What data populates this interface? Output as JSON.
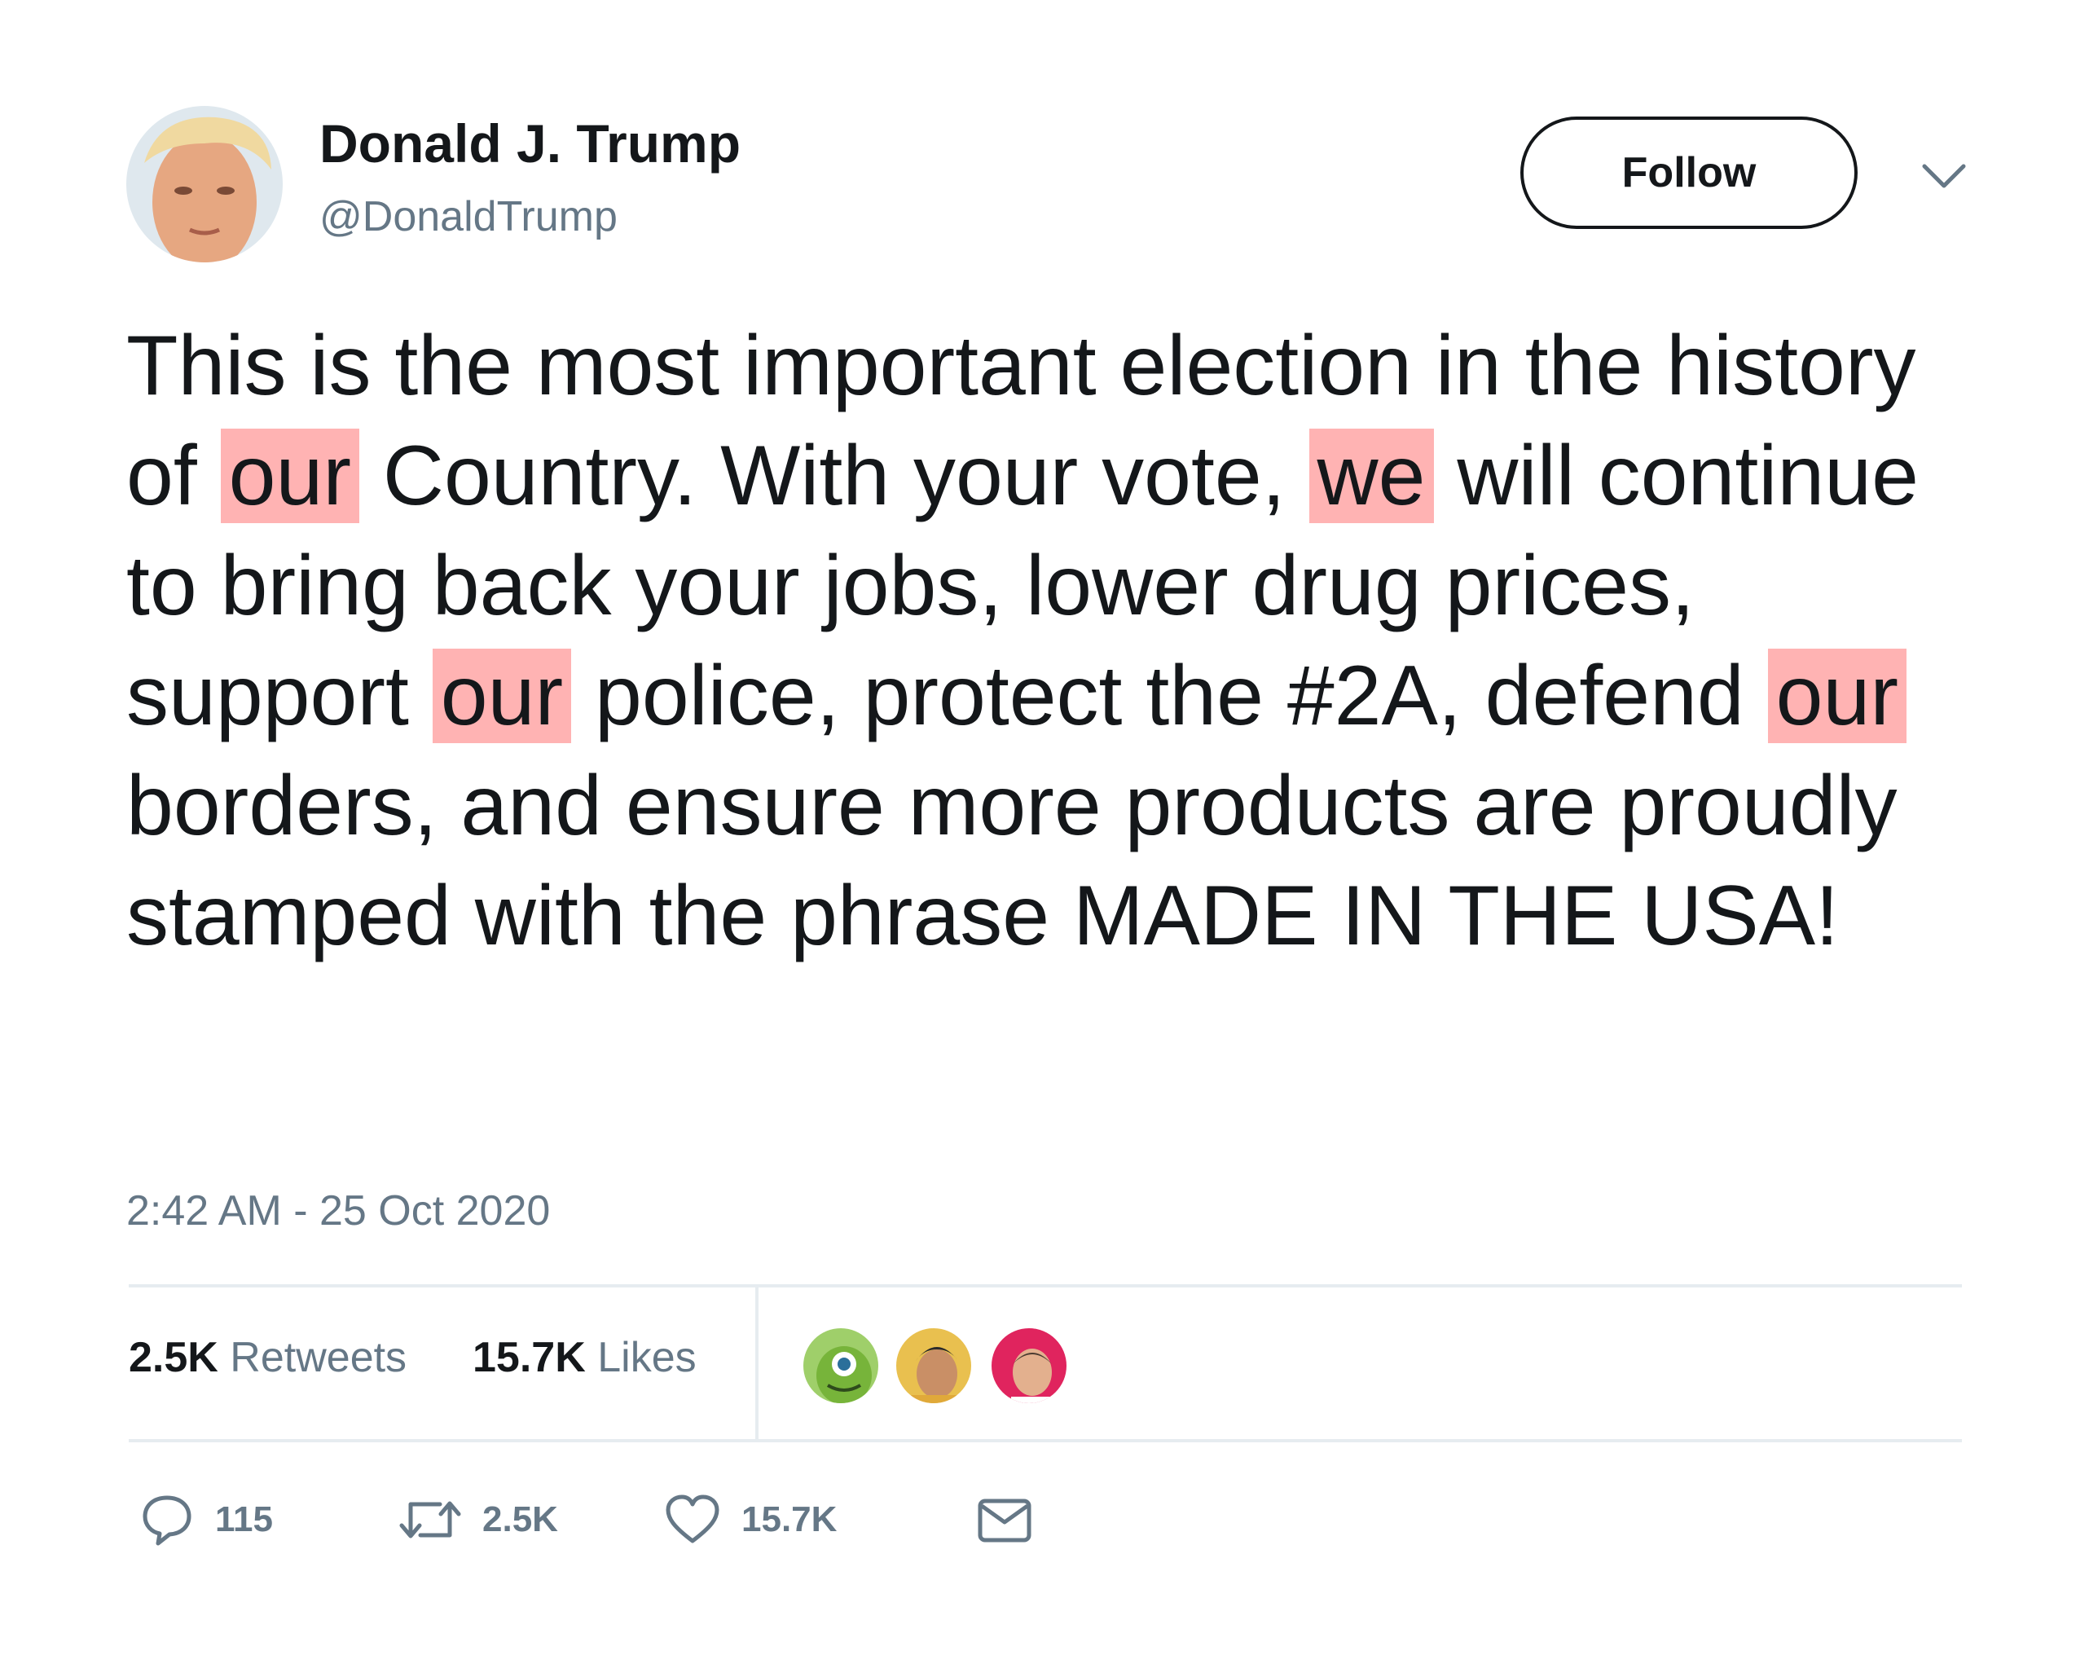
{
  "author": {
    "name": "Donald J. Trump",
    "handle": "@DonaldTrump"
  },
  "follow_button": {
    "label": "Follow"
  },
  "tweet": {
    "segments": [
      "This is the most important election in the history of ",
      "our",
      " Country. With your vote, ",
      "we",
      " will continue to bring back your jobs, lower drug prices, support ",
      "our",
      " police, protect the #2A, defend ",
      "our",
      " borders, and ensure more products are proudly stamped with the phrase MADE IN THE USA!"
    ],
    "highlight_color": "#ffb3b3"
  },
  "timestamp": "2:42 AM - 25 Oct 2020",
  "stats": {
    "retweets_count": "2.5K",
    "retweets_label": "Retweets",
    "likes_count": "15.7K",
    "likes_label": "Likes"
  },
  "actions": {
    "reply_count": "115",
    "retweet_count": "2.5K",
    "like_count": "15.7K"
  },
  "icons": [
    "caret-down-icon",
    "reply-icon",
    "retweet-icon",
    "heart-icon",
    "mail-icon"
  ],
  "colors": {
    "text": "#14171a",
    "secondary": "#657786",
    "divider": "#e6ecf0"
  }
}
